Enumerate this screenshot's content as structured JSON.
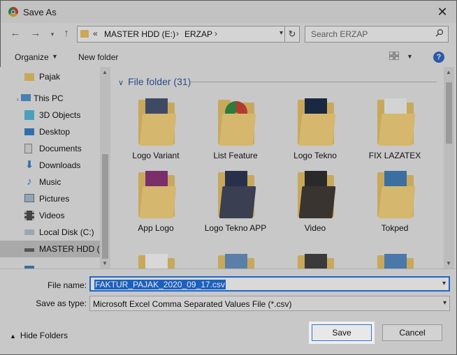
{
  "window": {
    "title": "Save As"
  },
  "nav": {
    "breadcrumb_prefix": "«",
    "breadcrumb": [
      "MASTER HDD (E:)",
      "ERZAP"
    ],
    "search_placeholder": "Search ERZAP"
  },
  "toolbar": {
    "organize": "Organize",
    "new_folder": "New folder",
    "help": "?"
  },
  "sidebar": {
    "items": [
      {
        "label": "Pajak",
        "icon": "folder-icon"
      },
      {
        "label": "This PC",
        "icon": "computer-icon"
      },
      {
        "label": "3D Objects",
        "icon": "cube-icon"
      },
      {
        "label": "Desktop",
        "icon": "desktop-icon"
      },
      {
        "label": "Documents",
        "icon": "documents-icon"
      },
      {
        "label": "Downloads",
        "icon": "download-icon"
      },
      {
        "label": "Music",
        "icon": "music-icon"
      },
      {
        "label": "Pictures",
        "icon": "pictures-icon"
      },
      {
        "label": "Videos",
        "icon": "videos-icon"
      },
      {
        "label": "Local Disk (C:)",
        "icon": "drive-icon"
      },
      {
        "label": "MASTER HDD (E",
        "icon": "drive-icon",
        "selected": true
      }
    ]
  },
  "content": {
    "group_header": "File folder (31)",
    "folders": [
      "Logo Variant",
      "List Feature",
      "Logo Tekno",
      "FIX LAZATEX",
      "App Logo",
      "Logo Tekno APP",
      "Video",
      "Tokped"
    ]
  },
  "footer": {
    "file_name_label": "File name:",
    "file_name_value": "FAKTUR_PAJAK_2020_09_17.csv",
    "save_type_label": "Save as type:",
    "save_type_value": "Microsoft Excel Comma Separated Values File (*.csv)",
    "hide_folders": "Hide Folders",
    "save": "Save",
    "cancel": "Cancel"
  },
  "colors": {
    "accent": "#1e66c8",
    "selection": "#1b60c0",
    "header_text": "#2b4f88"
  }
}
